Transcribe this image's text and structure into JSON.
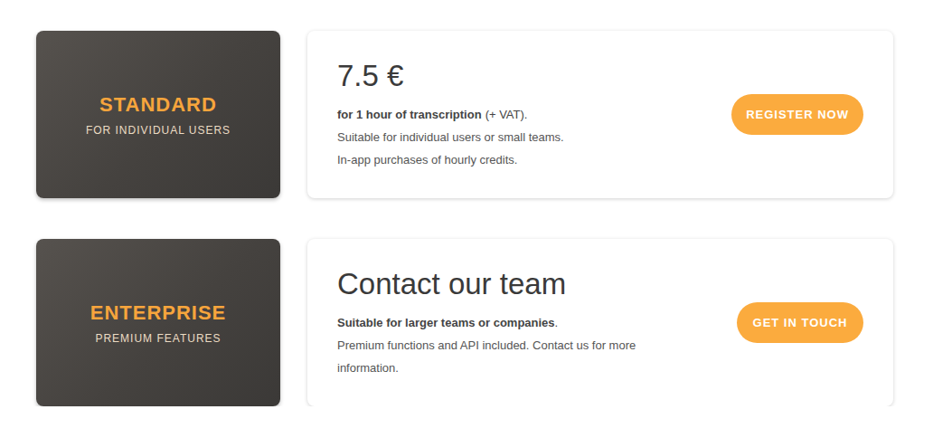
{
  "plans": [
    {
      "name": "STANDARD",
      "subtitle": "FOR INDIVIDUAL USERS",
      "headline": "7.5 €",
      "lead_bold": "for 1 hour of transcription",
      "lead_rest": "(+ VAT).",
      "lines": [
        "Suitable for individual users or small teams.",
        "In-app purchases of hourly credits."
      ],
      "button": "REGISTER NOW"
    },
    {
      "name": "ENTERPRISE",
      "subtitle": "PREMIUM FEATURES",
      "headline": "Contact our team",
      "lead_bold": "Suitable for larger teams or companies",
      "lead_rest": ".",
      "lines": [
        "Premium functions and API included. Contact us for more information."
      ],
      "button": "GET IN TOUCH"
    }
  ]
}
